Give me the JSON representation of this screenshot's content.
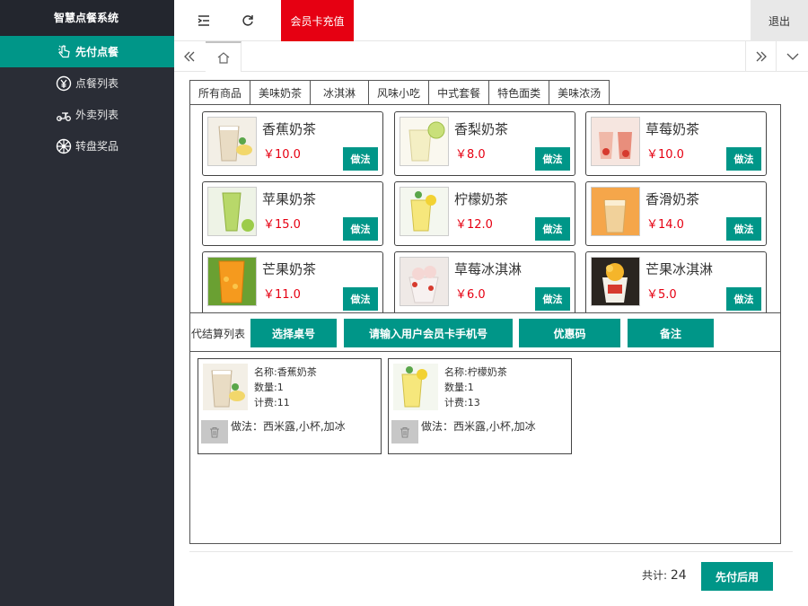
{
  "sidebar": {
    "brand": "智慧点餐系统",
    "items": [
      {
        "label": "先付点餐",
        "icon": "hand-pointer-icon"
      },
      {
        "label": "点餐列表",
        "icon": "yen-circle-icon"
      },
      {
        "label": "外卖列表",
        "icon": "scooter-icon"
      },
      {
        "label": "转盘奖品",
        "icon": "wheel-icon"
      }
    ]
  },
  "header": {
    "recharge": "会员卡充值",
    "logout": "退出"
  },
  "categories": [
    "所有商品",
    "美味奶茶",
    "冰淇淋",
    "风味小吃",
    "中式套餐",
    "特色面类",
    "美味浓汤"
  ],
  "products": [
    {
      "name": "香蕉奶茶",
      "price": "￥10.0",
      "button": "做法"
    },
    {
      "name": "香梨奶茶",
      "price": "￥8.0",
      "button": "做法"
    },
    {
      "name": "草莓奶茶",
      "price": "￥10.0",
      "button": "做法"
    },
    {
      "name": "苹果奶茶",
      "price": "￥15.0",
      "button": "做法"
    },
    {
      "name": "柠檬奶茶",
      "price": "￥12.0",
      "button": "做法"
    },
    {
      "name": "香滑奶茶",
      "price": "￥14.0",
      "button": "做法"
    },
    {
      "name": "芒果奶茶",
      "price": "￥11.0",
      "button": "做法"
    },
    {
      "name": "草莓冰淇淋",
      "price": "￥6.0",
      "button": "做法"
    },
    {
      "name": "芒果冰淇淋",
      "price": "￥5.0",
      "button": "做法"
    }
  ],
  "action_bar": {
    "label": "代结算列表",
    "select_table": "选择桌号",
    "member_phone": "请输入用户会员卡手机号",
    "coupon": "优惠码",
    "note": "备注"
  },
  "orders": [
    {
      "name": "名称:香蕉奶茶",
      "qty": "数量:1",
      "fee": "计费:11",
      "method": "做法：西米露,小杯,加冰"
    },
    {
      "name": "名称:柠檬奶茶",
      "qty": "数量:1",
      "fee": "计费:13",
      "method": "做法：西米露,小杯,加冰"
    }
  ],
  "footer": {
    "total_label": "共计:",
    "total_value": "24",
    "pay_button": "先付后用"
  },
  "colors": {
    "accent": "#009688",
    "sidebar_bg": "#2a2d36",
    "recharge": "#e60012",
    "price": "#e60012"
  }
}
